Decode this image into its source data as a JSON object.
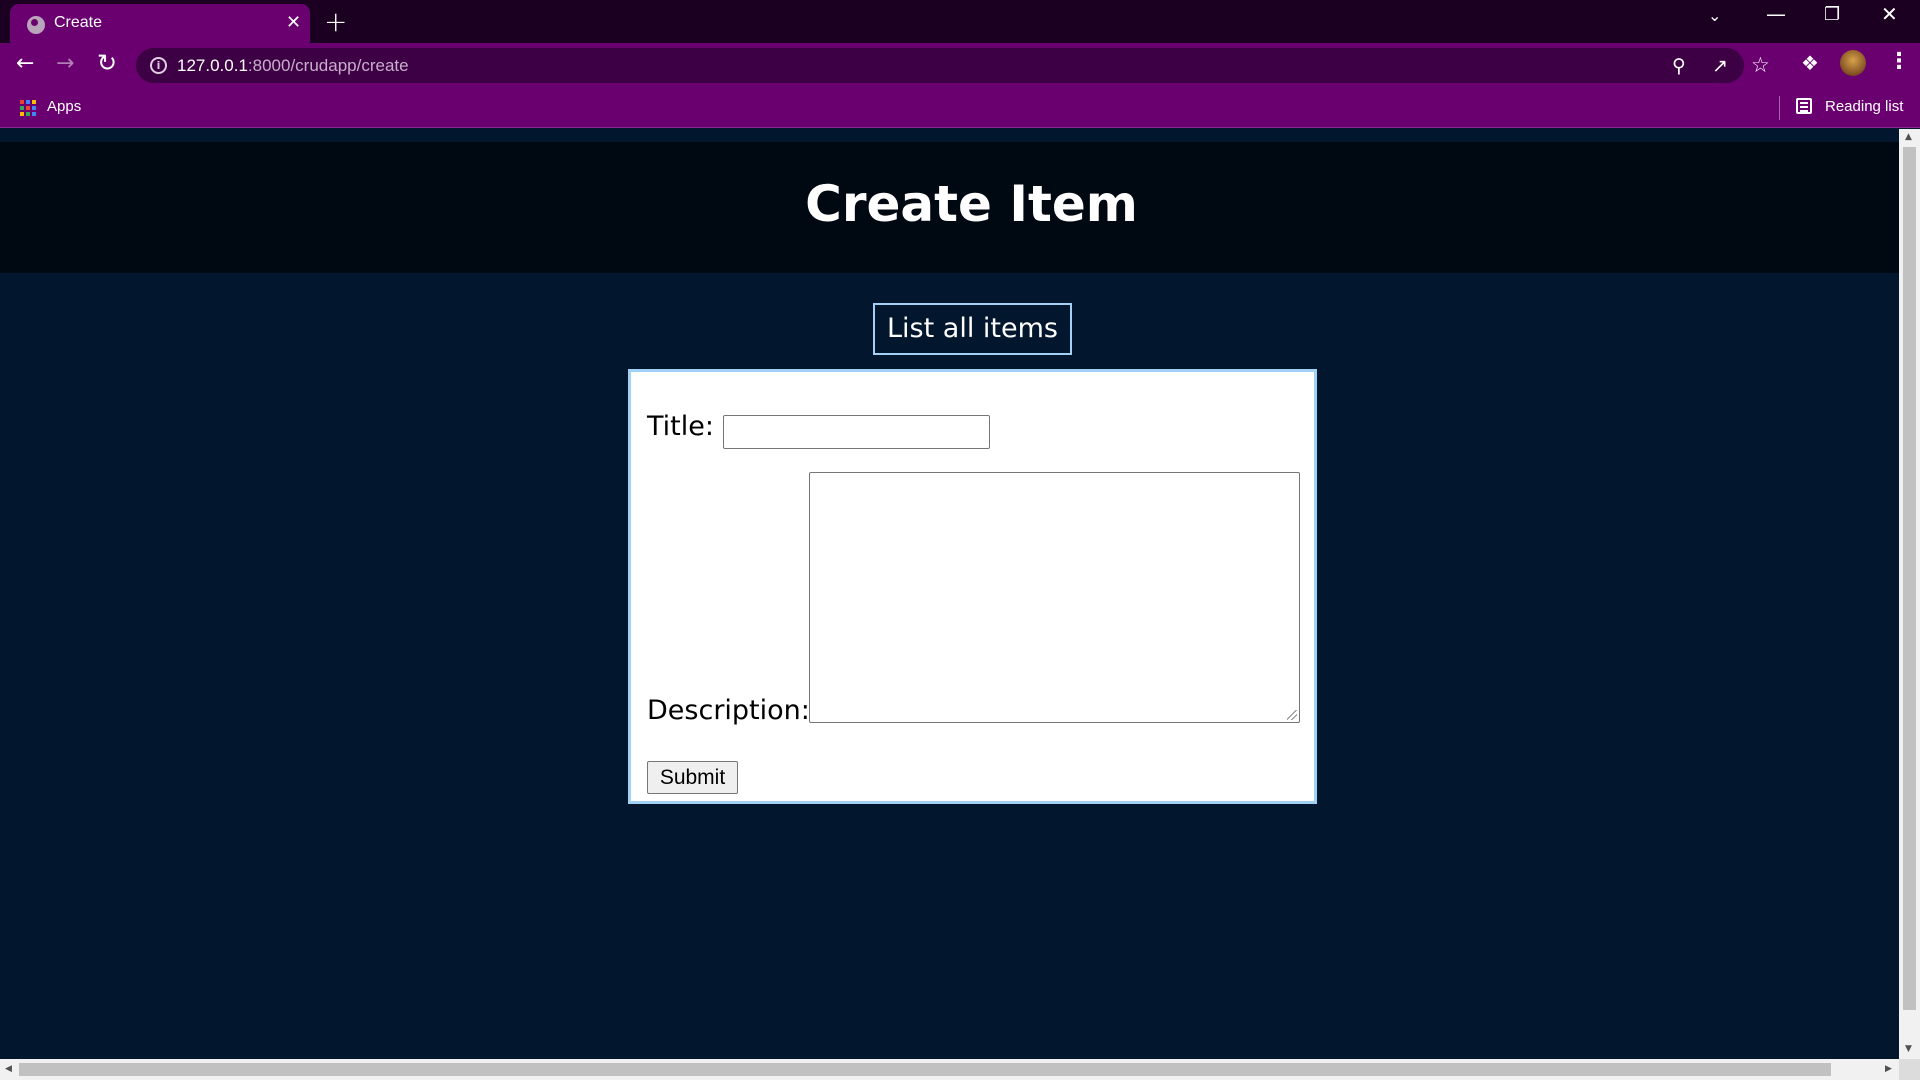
{
  "browser": {
    "tab_title": "Create",
    "tab_close_glyph": "✕",
    "new_tab_glyph": "+",
    "url_host": "127.0.0.1",
    "url_rest": ":8000/crudapp/create",
    "bookmarks": {
      "apps_label": "Apps",
      "reading_list_label": "Reading list"
    },
    "colors": {
      "frame": "#1c0021",
      "toolbar": "#6a0070",
      "omnibox": "#3d0044"
    }
  },
  "page": {
    "title": "Create Item",
    "list_link_label": "List all items",
    "form": {
      "title_label": "Title:",
      "title_value": "",
      "description_label": "Description:",
      "description_value": "",
      "submit_label": "Submit"
    },
    "colors": {
      "background": "#02172d",
      "header_background": "#000812",
      "accent_border": "#a3d0f5"
    }
  }
}
